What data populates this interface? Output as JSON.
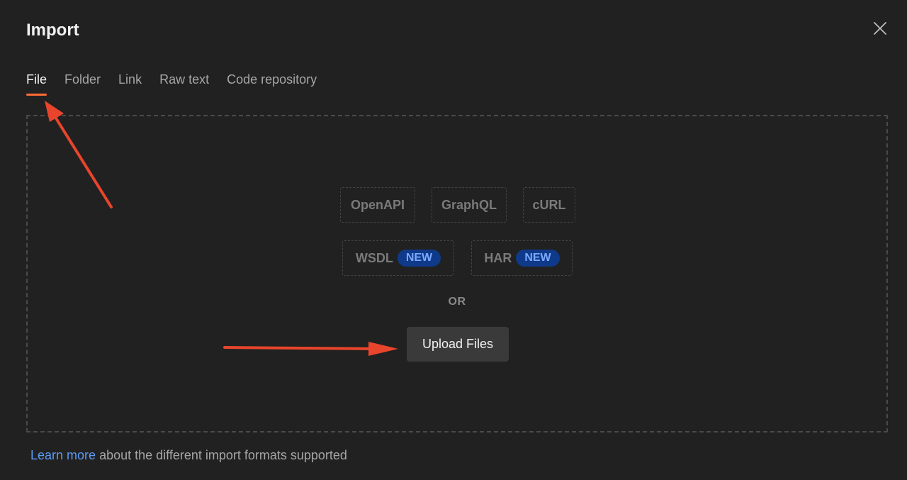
{
  "dialog": {
    "title": "Import",
    "close_icon": "close-icon"
  },
  "tabs": [
    {
      "label": "File",
      "active": true
    },
    {
      "label": "Folder",
      "active": false
    },
    {
      "label": "Link",
      "active": false
    },
    {
      "label": "Raw text",
      "active": false
    },
    {
      "label": "Code repository",
      "active": false
    }
  ],
  "formats": {
    "openapi": "OpenAPI",
    "graphql": "GraphQL",
    "curl": "cURL",
    "wsdl": "WSDL",
    "har": "HAR",
    "new_badge": "NEW"
  },
  "dropzone": {
    "or_label": "OR",
    "upload_label": "Upload Files"
  },
  "footer": {
    "link_text": "Learn more",
    "rest_text": " about the different import formats supported"
  },
  "colors": {
    "background": "#212121",
    "accent": "#ff6c37",
    "link": "#5b9bf5",
    "badge_bg": "#0f3a8a",
    "annotation_arrow": "#e8452c"
  }
}
